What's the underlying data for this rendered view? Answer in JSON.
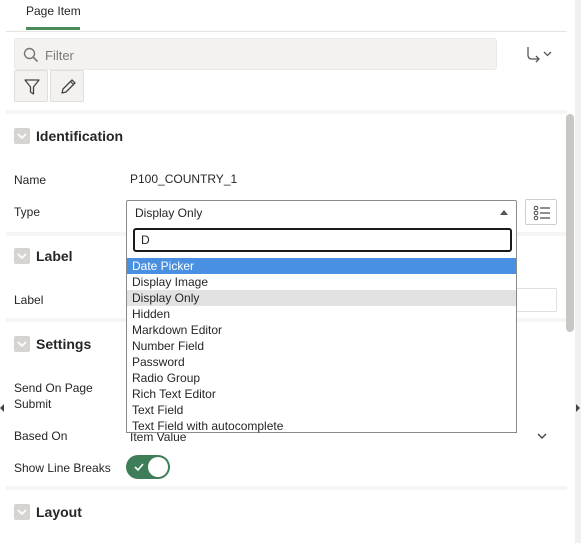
{
  "tabs": [
    {
      "label": "Page Item"
    }
  ],
  "search": {
    "placeholder": "Filter"
  },
  "toolbar": {
    "filter_icon": "filter-icon",
    "edit_icon": "pencil-icon",
    "goto_icon": "goto-arrow-icon"
  },
  "sections": {
    "identification": {
      "title": "Identification",
      "name_label": "Name",
      "name_value": "P100_COUNTRY_1",
      "type_label": "Type",
      "type_value": "Display Only"
    },
    "label": {
      "title": "Label",
      "label_label": "Label"
    },
    "settings": {
      "title": "Settings",
      "send_on_submit_label": "Send On Page Submit",
      "based_on_label": "Based On",
      "based_on_value": "Item Value",
      "show_line_breaks_label": "Show Line Breaks",
      "show_line_breaks_on": true
    },
    "layout": {
      "title": "Layout"
    }
  },
  "type_dropdown": {
    "search_value": "D",
    "options": [
      "Date Picker",
      "Display Image",
      "Display Only",
      "Hidden",
      "Markdown Editor",
      "Number Field",
      "Password",
      "Radio Group",
      "Rich Text Editor",
      "Text Field",
      "Text Field with autocomplete"
    ],
    "active_index": 0,
    "selected_index": 2
  },
  "colors": {
    "accent": "#4a8b5c",
    "toggle_on": "#3d7d57",
    "highlight": "#4a90e2"
  }
}
